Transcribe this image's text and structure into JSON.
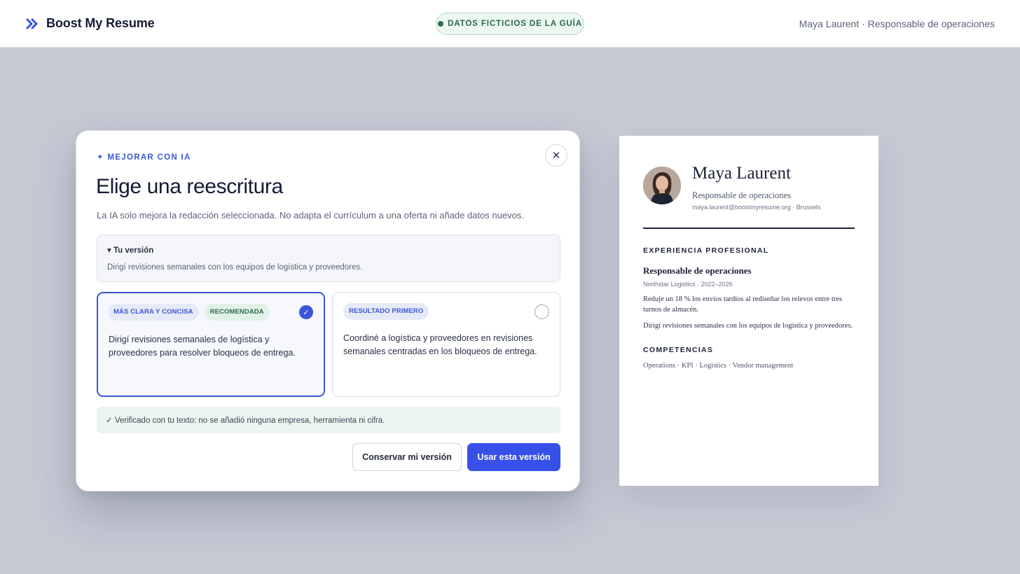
{
  "header": {
    "brand": "Boost My Resume",
    "brand_icon": "double-chevron-right-icon",
    "guide_badge": "DATOS FICTICIOS DE LA GUÍA",
    "user_info": "Maya Laurent · Responsable de operaciones"
  },
  "modal": {
    "eyebrow": "✦ MEJORAR CON IA",
    "close_icon": "close-icon",
    "title": "Elige una reescritura",
    "description": "La IA solo mejora la redacción seleccionada. No adapta el currículum a una oferta ni añade datos nuevos.",
    "original": {
      "label": "▾ Tu versión",
      "text": "Dirigí revisiones semanales con los equipos de logística y proveedores."
    },
    "options": [
      {
        "tags": [
          "MÁS CLARA Y CONCISA",
          "RECOMENDADA"
        ],
        "text": "Dirigí revisiones semanales de logística y proveedores para resolver bloqueos de entrega.",
        "selected": true
      },
      {
        "tags": [
          "RESULTADO PRIMERO"
        ],
        "text": "Coordiné a logística y proveedores en revisiones semanales centradas en los bloqueos de entrega.",
        "selected": false
      }
    ],
    "verified": "✓ Verificado con tu texto: no se añadió ninguna empresa, herramienta ni cifra.",
    "buttons": {
      "keep": "Conservar mi versión",
      "use": "Usar esta versión"
    }
  },
  "resume": {
    "name": "Maya Laurent",
    "role": "Responsable de operaciones",
    "contact": "maya.laurent@boostmyresume.org · Brussels",
    "sections": {
      "experience": "EXPERIENCIA PROFESIONAL",
      "skills": "COMPETENCIAS"
    },
    "job": {
      "title": "Responsable de operaciones",
      "meta": "Northstar Logistics · 2022–2026",
      "bullets": [
        "Reduje un 18 % los envíos tardíos al rediseñar los relevos entre tres turnos de almacén.",
        "Dirigí revisiones semanales con los equipos de logística y proveedores."
      ]
    },
    "skills": "Operations · KPI · Logistics · Vendor management"
  },
  "colors": {
    "accent": "#3650e8",
    "success": "#2b6a45",
    "backdrop": "#c5c9d4"
  }
}
